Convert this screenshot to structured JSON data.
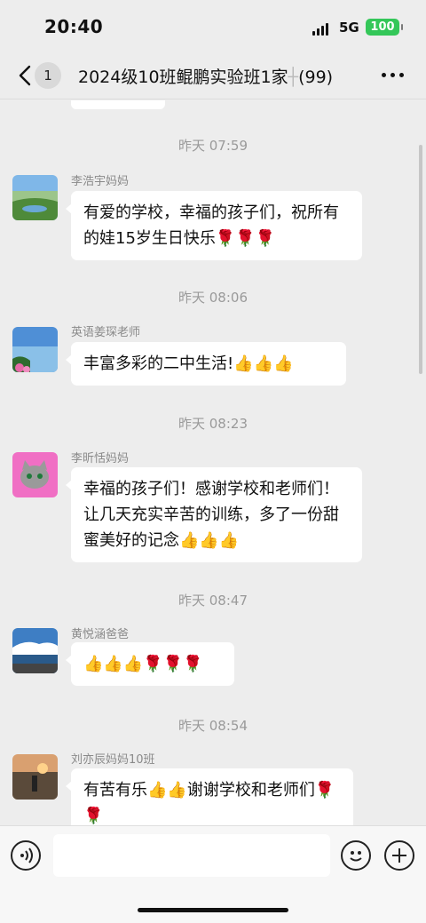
{
  "status": {
    "time": "20:40",
    "network": "5G",
    "battery": "100"
  },
  "nav": {
    "unread": "1",
    "title": "2024级10班鲲鹏实验班1家",
    "count": "(99)"
  },
  "messages": [
    {
      "time": "昨天 07:59",
      "sender": "李浩宇妈妈",
      "text": "有爱的学校，幸福的孩子们，祝所有的娃15岁生日快乐🌹🌹🌹"
    },
    {
      "time": "昨天 08:06",
      "sender": "英语姜琛老师",
      "text": "丰富多彩的二中生活!👍👍👍"
    },
    {
      "time": "昨天 08:23",
      "sender": "李昕恬妈妈",
      "text": "幸福的孩子们！感谢学校和老师们！让几天充实辛苦的训练，多了一份甜蜜美好的记念👍👍👍"
    },
    {
      "time": "昨天 08:47",
      "sender": "黄悦涵爸爸",
      "text": "👍👍👍🌹🌹🌹"
    },
    {
      "time": "昨天 08:54",
      "sender": "刘亦辰妈妈10班",
      "text": "有苦有乐👍👍谢谢学校和老师们🌹🌹"
    }
  ],
  "icons": {
    "back": "chevron-left-icon",
    "more": "more-dots-icon",
    "voice": "voice-icon",
    "emoji": "emoji-icon",
    "plus": "plus-icon"
  },
  "colors": {
    "battery": "#34c759",
    "background": "#ededed",
    "bubble": "#ffffff"
  }
}
